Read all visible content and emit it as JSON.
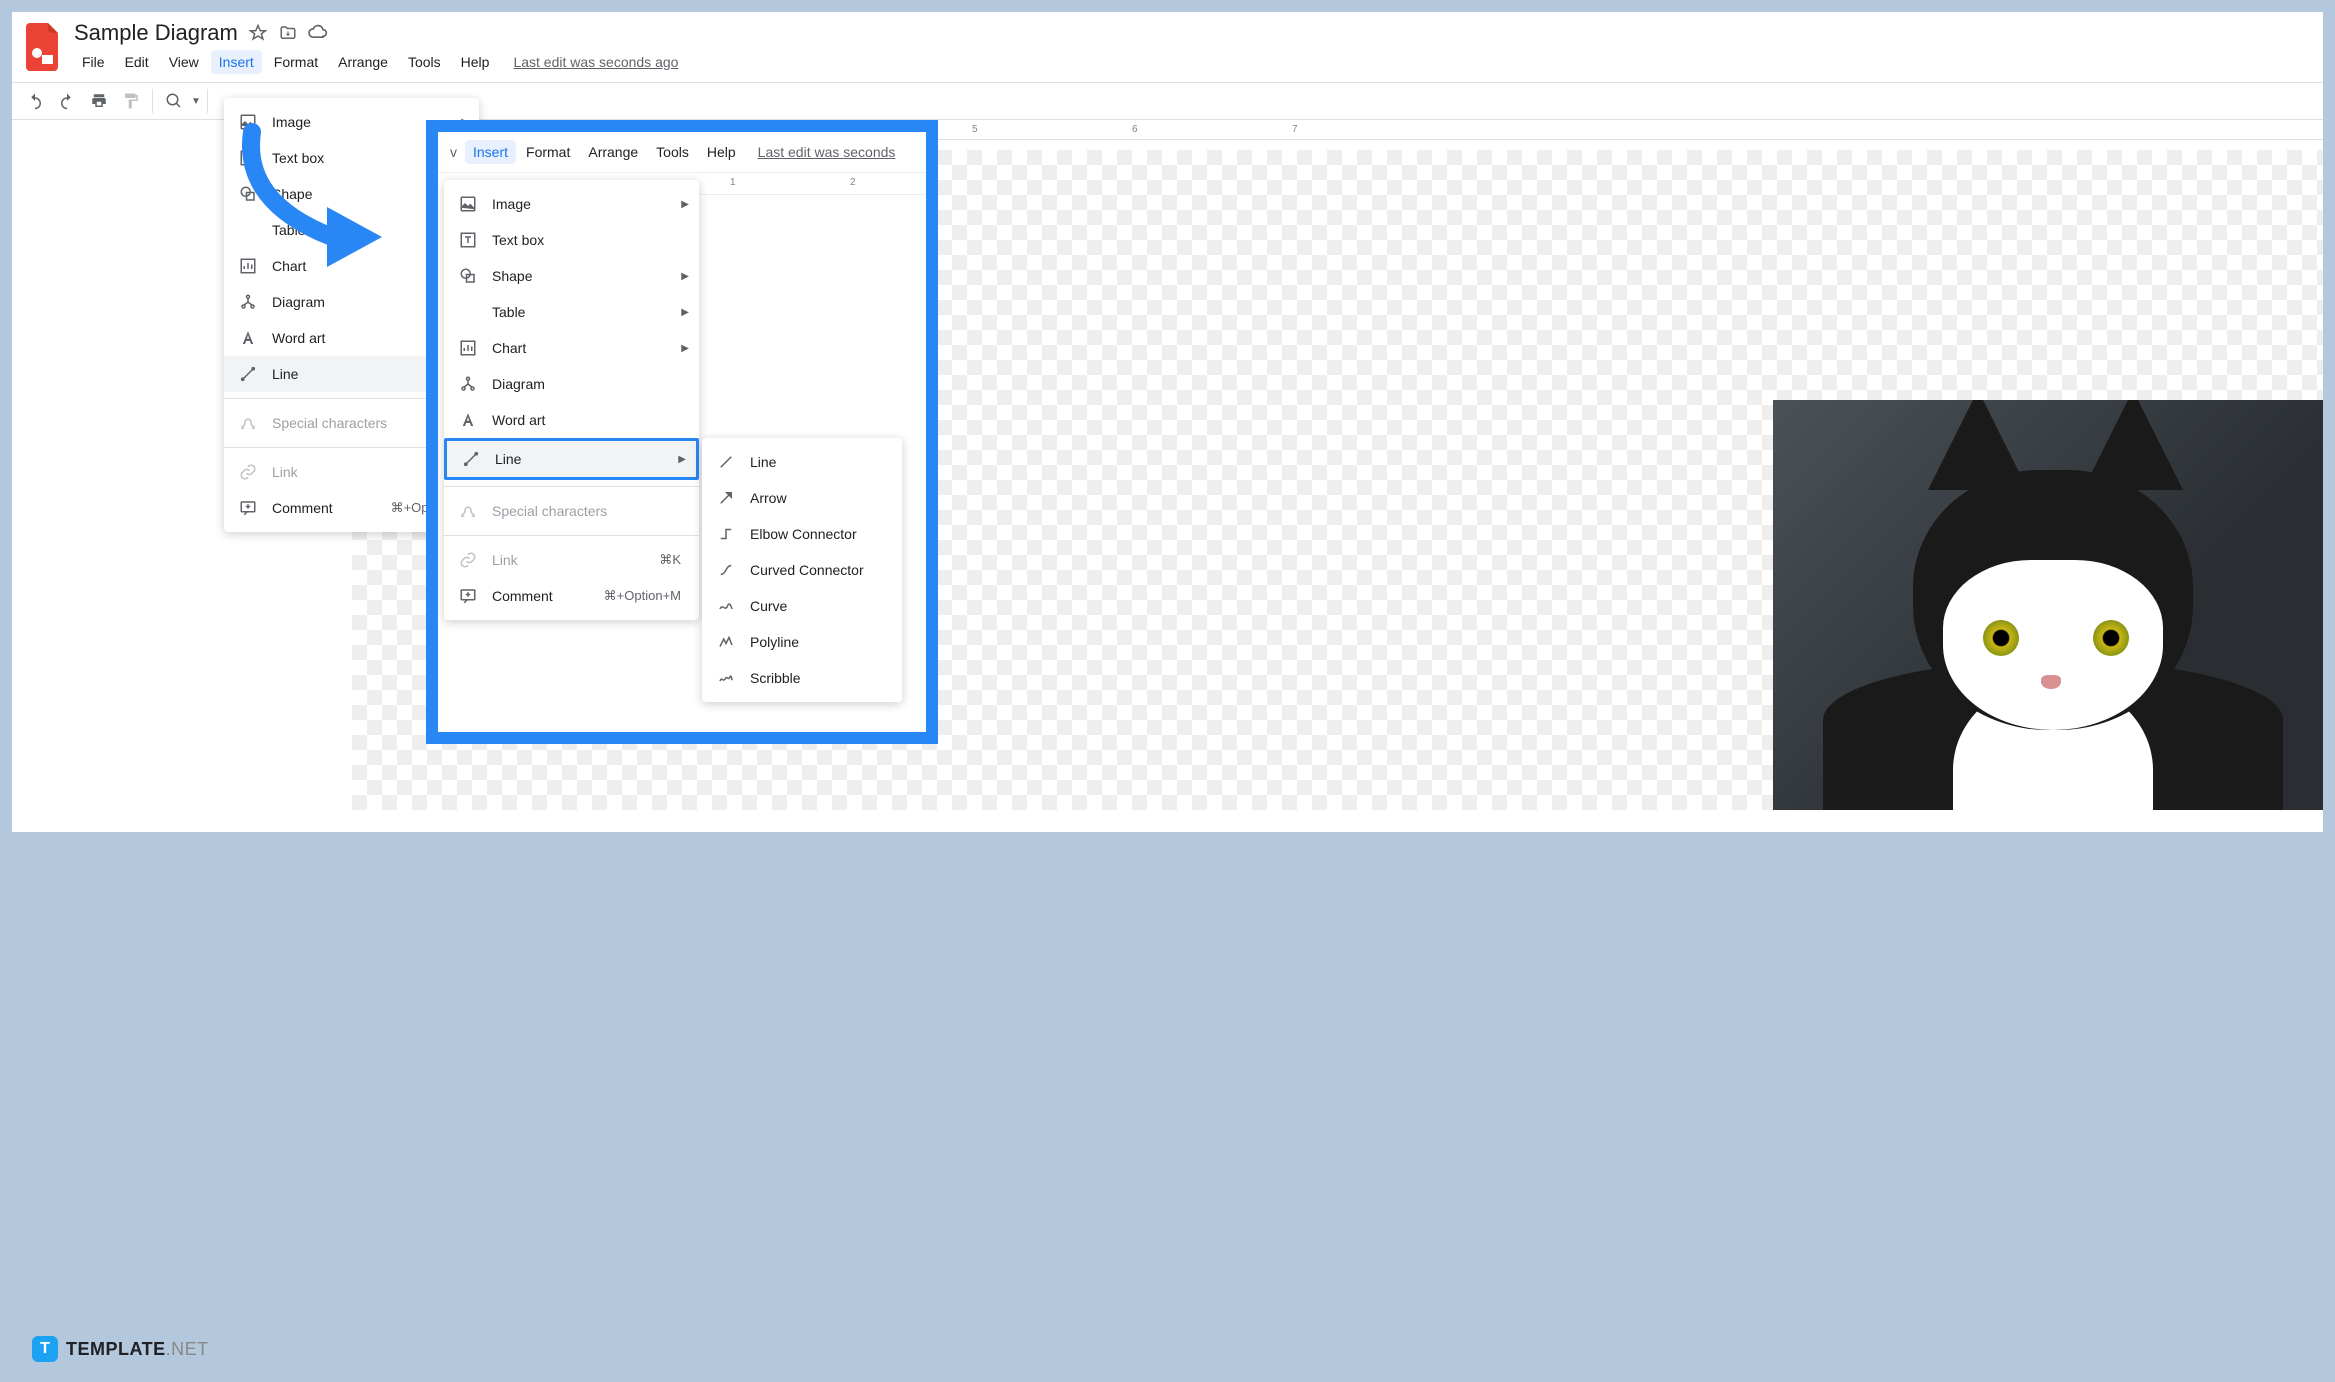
{
  "doc": {
    "title": "Sample Diagram"
  },
  "menu": {
    "file": "File",
    "edit": "Edit",
    "view": "View",
    "insert": "Insert",
    "format": "Format",
    "arrange": "Arrange",
    "tools": "Tools",
    "help": "Help",
    "last_edit": "Last edit was seconds ago"
  },
  "insert_menu": {
    "image": "Image",
    "textbox": "Text box",
    "shape": "Shape",
    "table": "Table",
    "chart": "Chart",
    "diagram": "Diagram",
    "wordart": "Word art",
    "line": "Line",
    "special": "Special characters",
    "link": "Link",
    "comment": "Comment",
    "comment_shortcut": "⌘+Option+M",
    "link_shortcut": "⌘K"
  },
  "overlay_menu": {
    "insert": "Insert",
    "format": "Format",
    "arrange": "Arrange",
    "tools": "Tools",
    "help": "Help",
    "last_edit": "Last edit was seconds"
  },
  "line_submenu": {
    "line": "Line",
    "arrow": "Arrow",
    "elbow": "Elbow Connector",
    "curved": "Curved Connector",
    "curve": "Curve",
    "polyline": "Polyline",
    "scribble": "Scribble"
  },
  "ruler": {
    "t5": "5",
    "t6": "6",
    "t7": "7",
    "ov1": "1",
    "ov2": "2"
  },
  "watermark": {
    "brand": "TEMPLATE",
    "suffix": ".NET",
    "logo": "T"
  }
}
